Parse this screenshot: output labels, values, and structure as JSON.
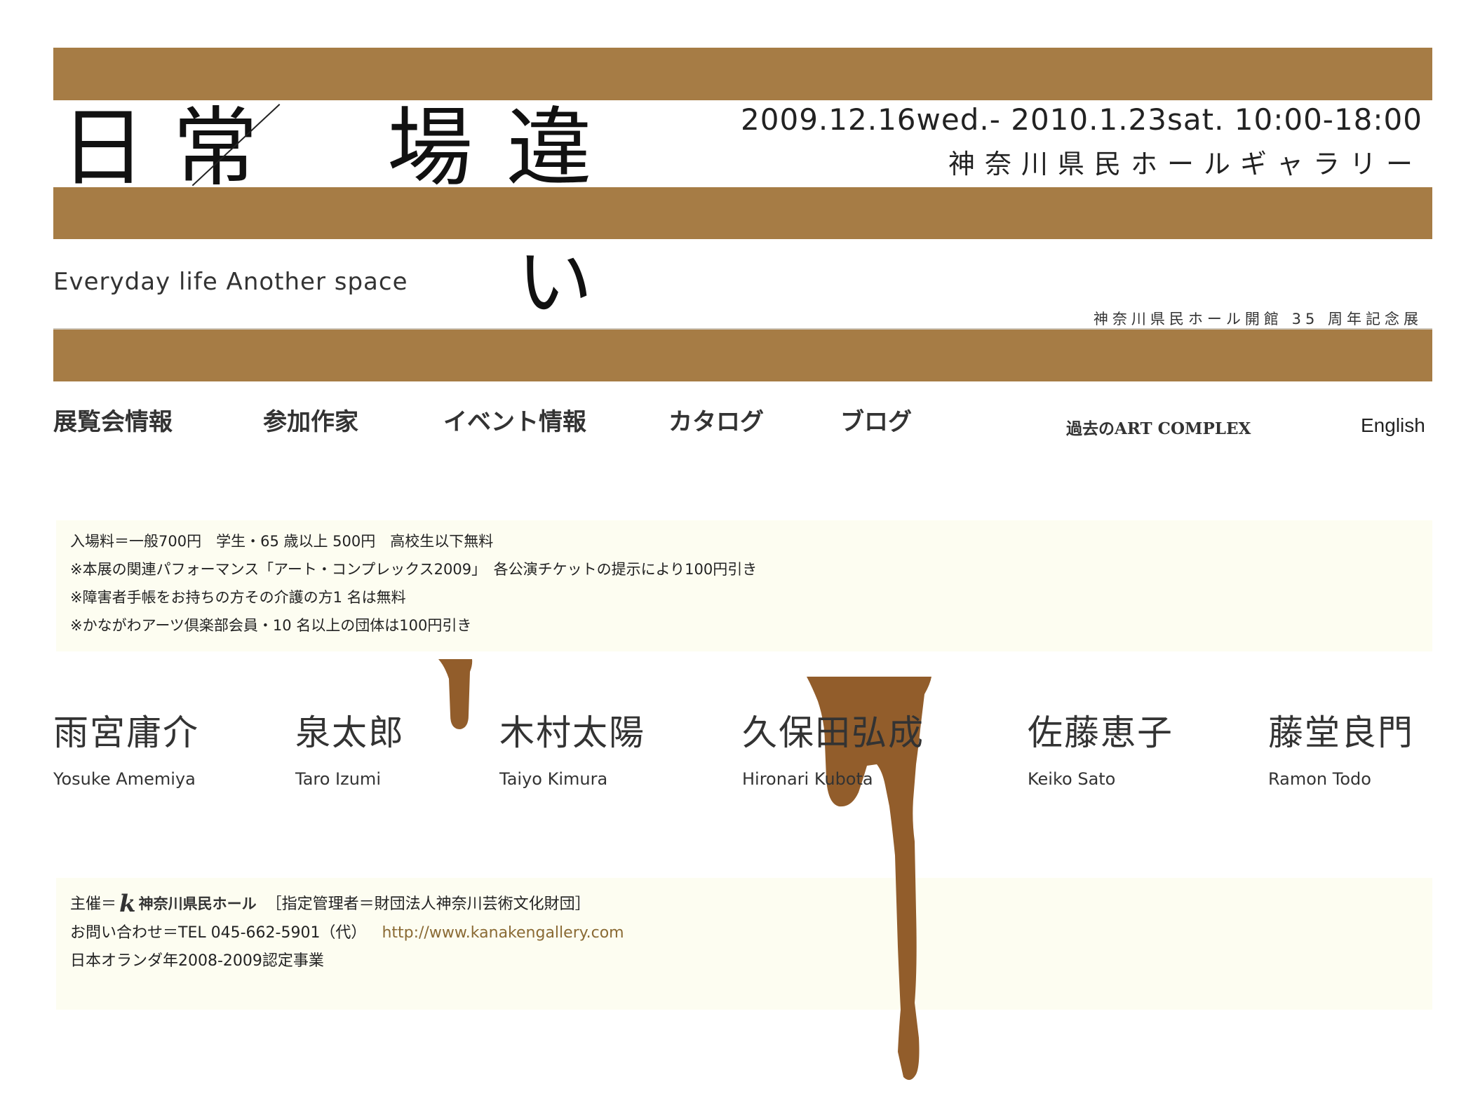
{
  "colors": {
    "band": "#a67c45",
    "drip": "#925d2b",
    "infoBg": "#fdfdf1",
    "link": "#8a6a34"
  },
  "header": {
    "title_chars": [
      "日",
      "常",
      "場",
      "違"
    ],
    "title_tail": "い",
    "dates": "2009.12.16wed.- 2010.1.23sat. 10:00-18:00",
    "venue": "神奈川県民ホールギャラリー",
    "subtitle_en": "Everyday life Another space",
    "anniversary": "神奈川県民ホール開館 35 周年記念展"
  },
  "nav": [
    {
      "label": "展覧会情報"
    },
    {
      "label": "参加作家"
    },
    {
      "label": "イベント情報"
    },
    {
      "label": "カタログ"
    },
    {
      "label": "ブログ"
    },
    {
      "label": "過去のART COMPLEX"
    },
    {
      "label": "English"
    }
  ],
  "info": [
    "入場料＝一般700円　学生・65 歳以上 500円　高校生以下無料",
    "※本展の関連パフォーマンス「アート・コンプレックス2009」　各公演チケットの提示により100円引き",
    "※障害者手帳をお持ちの方その介護の方1 名は無料",
    "※かながわアーツ倶楽部会員・10 名以上の団体は100円引き"
  ],
  "artists": [
    {
      "jp": "雨宮庸介",
      "en": "Yosuke Amemiya"
    },
    {
      "jp": "泉太郎",
      "en": "Taro Izumi"
    },
    {
      "jp": "木村太陽",
      "en": "Taiyo Kimura"
    },
    {
      "jp": "久保田弘成",
      "en": "Hironari Kubota"
    },
    {
      "jp": "佐藤恵子",
      "en": "Keiko Sato"
    },
    {
      "jp": "藤堂良門",
      "en": "Ramon Todo"
    }
  ],
  "footer": {
    "organizer_prefix": "主催＝",
    "logo_letter": "k",
    "logo_name": "神奈川県民ホール",
    "organizer_suffix": "［指定管理者＝財団法人神奈川芸術文化財団］",
    "contact": "お問い合わせ＝TEL 045-662-5901（代）",
    "url": "http://www.kanakengallery.com",
    "certified": "日本オランダ年2008-2009認定事業"
  }
}
